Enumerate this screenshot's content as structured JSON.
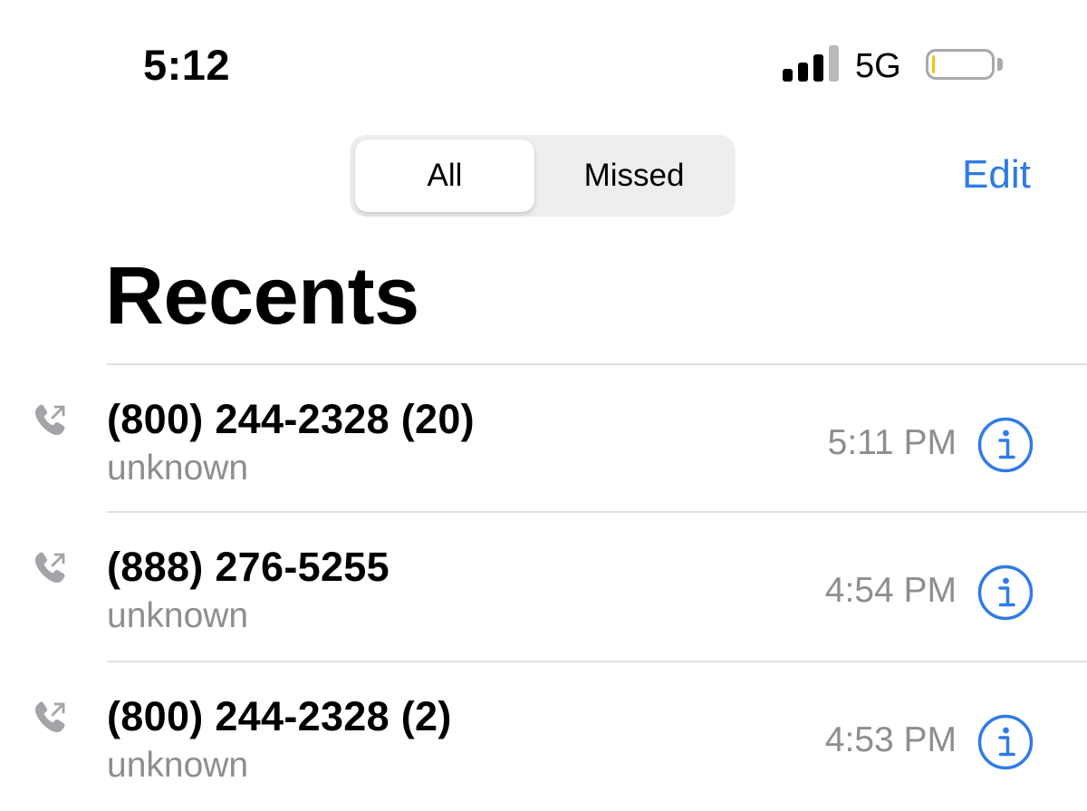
{
  "status_bar": {
    "time": "5:12",
    "network": "5G",
    "signal_bars_filled": 3,
    "signal_bars_total": 4,
    "battery_level_percent": 5,
    "battery_color": "#f5c400"
  },
  "segmented_control": {
    "options": [
      "All",
      "Missed"
    ],
    "selected": "All"
  },
  "edit_label": "Edit",
  "title": "Recents",
  "accent_color": "#2f7be6",
  "calls": [
    {
      "number": "(800) 244-2328 (20)",
      "label": "unknown",
      "time": "5:11 PM",
      "icon": "outgoing-call-icon"
    },
    {
      "number": "(888) 276-5255",
      "label": "unknown",
      "time": "4:54 PM",
      "icon": "outgoing-call-icon"
    },
    {
      "number": "(800) 244-2328 (2)",
      "label": "unknown",
      "time": "4:53 PM",
      "icon": "outgoing-call-icon"
    }
  ]
}
